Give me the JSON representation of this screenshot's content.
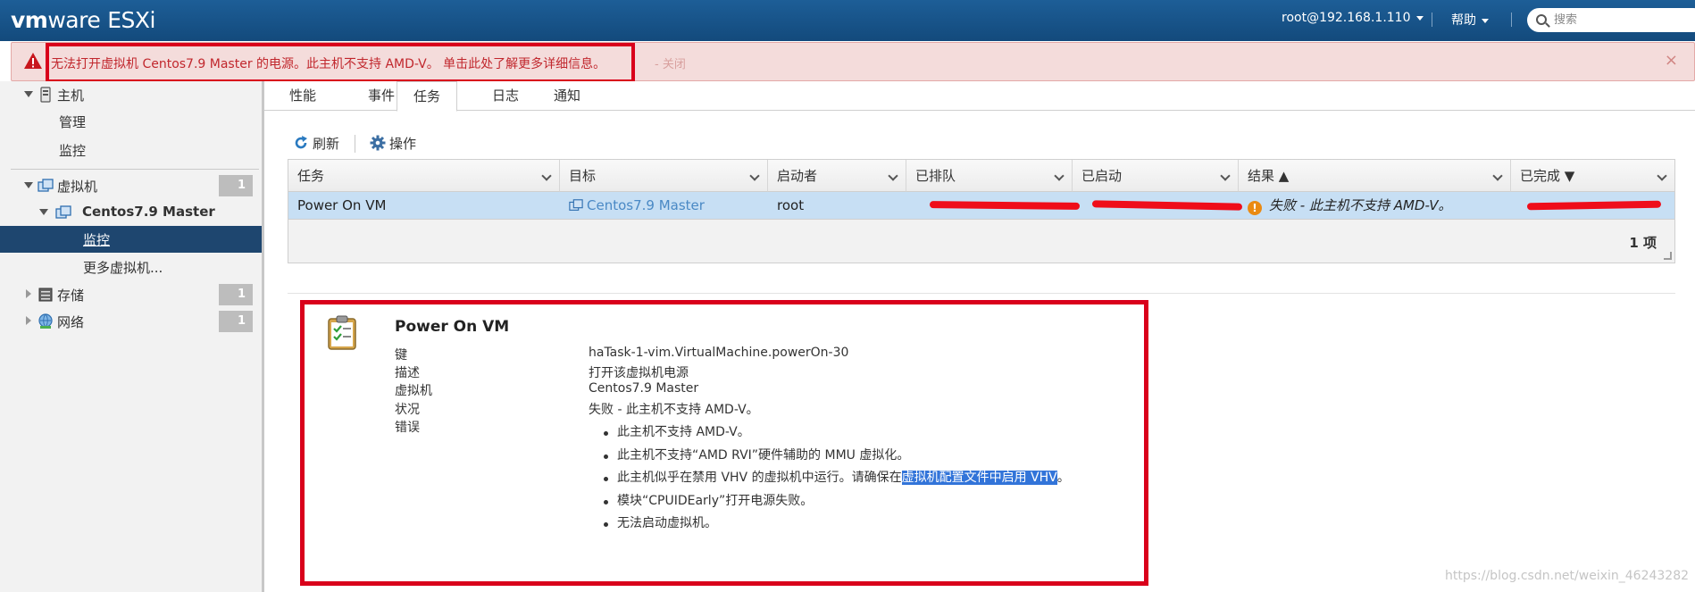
{
  "header": {
    "logo_vm": "vm",
    "logo_ware": "ware",
    "logo_esxi": "ESXi",
    "user": "root@192.168.1.110",
    "help": "帮助",
    "search_placeholder": "搜索"
  },
  "alert": {
    "message": "无法打开虚拟机 Centos7.9 Master 的电源。此主机不支持 AMD-V。 单击此处了解更多详细信息。",
    "close_link": "- 关闭",
    "dismiss": "×"
  },
  "sidebar": {
    "host": "主机",
    "manage": "管理",
    "monitor": "监控",
    "vms": "虚拟机",
    "vms_count": "1",
    "vm_name": "Centos7.9 Master",
    "vm_monitor": "监控",
    "more_vms": "更多虚拟机...",
    "storage": "存储",
    "storage_count": "1",
    "network": "网络",
    "network_count": "1"
  },
  "tabs": [
    "性能",
    "事件",
    "任务",
    "日志",
    "通知"
  ],
  "active_tab": "任务",
  "toolbar": {
    "refresh": "刷新",
    "actions": "操作"
  },
  "table": {
    "columns": [
      "任务",
      "目标",
      "启动者",
      "已排队",
      "已启动",
      "结果 ▲",
      "已完成 ▼"
    ],
    "row": {
      "task": "Power On VM",
      "target": "Centos7.9 Master",
      "initiator": "root",
      "result": "失败 - 此主机不支持 AMD-V。"
    },
    "count": "1 项"
  },
  "detail": {
    "title": "Power On VM",
    "labels": {
      "key": "键",
      "desc": "描述",
      "vm": "虚拟机",
      "state": "状况",
      "errors": "错误"
    },
    "values": {
      "key": "haTask-1-vim.VirtualMachine.powerOn-30",
      "desc": "打开该虚拟机电源",
      "vm": "Centos7.9 Master",
      "state": "失败 - 此主机不支持 AMD-V。"
    },
    "errors": [
      "此主机不支持 AMD-V。",
      "此主机不支持“AMD RVI”硬件辅助的 MMU 虚拟化。",
      "此主机似乎在禁用 VHV 的虚拟机中运行。请确保在",
      "模块“CPUIDEarly”打开电源失败。",
      "无法启动虚拟机。"
    ],
    "error_highlight": "虚拟机配置文件中启用 VHV",
    "error_tail": "。"
  },
  "watermark": "https://blog.csdn.net/weixin_46243282",
  "colors": {
    "topbar": "#1d5e97",
    "alert_bg": "#f4dcdb",
    "alert_text": "#c1272d",
    "selected_row": "#c7dff4",
    "nav_active": "#1e466f",
    "annotation_red": "#d9001b"
  }
}
